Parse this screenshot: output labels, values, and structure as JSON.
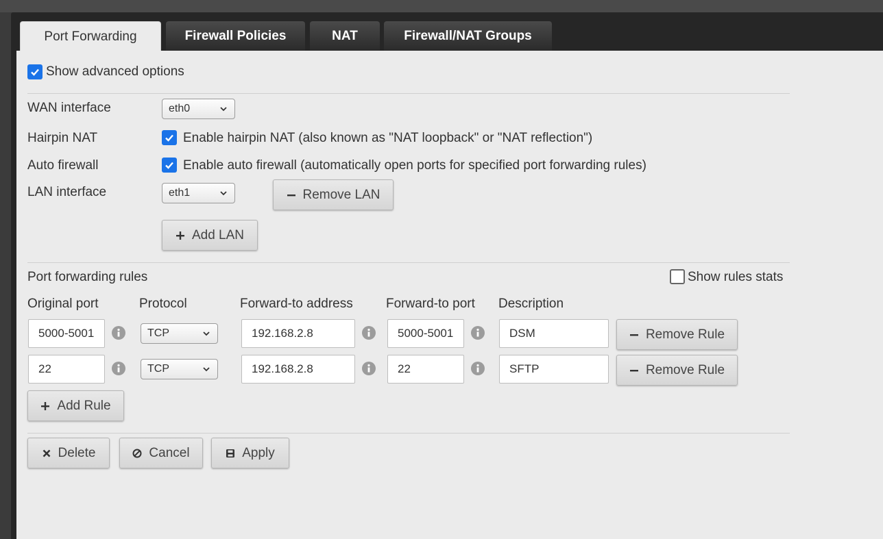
{
  "tabs": [
    {
      "label": "Port Forwarding",
      "active": true
    },
    {
      "label": "Firewall Policies",
      "active": false
    },
    {
      "label": "NAT",
      "active": false
    },
    {
      "label": "Firewall/NAT Groups",
      "active": false
    }
  ],
  "advanced": {
    "label": "Show advanced options",
    "checked": true
  },
  "wan": {
    "label": "WAN interface",
    "value": "eth0"
  },
  "hairpin": {
    "label": "Hairpin NAT",
    "option": "Enable hairpin NAT (also known as \"NAT loopback\" or \"NAT reflection\")",
    "checked": true
  },
  "autofw": {
    "label": "Auto firewall",
    "option": "Enable auto firewall (automatically open ports for specified port forwarding rules)",
    "checked": true
  },
  "lan": {
    "label": "LAN interface",
    "value": "eth1",
    "remove_label": "Remove LAN",
    "add_label": "Add LAN"
  },
  "rules": {
    "title": "Port forwarding rules",
    "stats_label": "Show rules stats",
    "stats_checked": false,
    "columns": [
      "Original port",
      "Protocol",
      "Forward-to address",
      "Forward-to port",
      "Description"
    ],
    "rows": [
      {
        "original_port": "5000-5001",
        "protocol": "TCP",
        "address": "192.168.2.8",
        "forward_port": "5000-5001",
        "description": "DSM",
        "remove_label": "Remove Rule"
      },
      {
        "original_port": "22",
        "protocol": "TCP",
        "address": "192.168.2.8",
        "forward_port": "22",
        "description": "SFTP",
        "remove_label": "Remove Rule"
      }
    ],
    "add_label": "Add Rule"
  },
  "actions": {
    "delete": "Delete",
    "cancel": "Cancel",
    "apply": "Apply"
  },
  "colors": {
    "accent": "#1a73e8",
    "panel": "#ebebeb",
    "tab_dark": "#2a2a2a"
  }
}
